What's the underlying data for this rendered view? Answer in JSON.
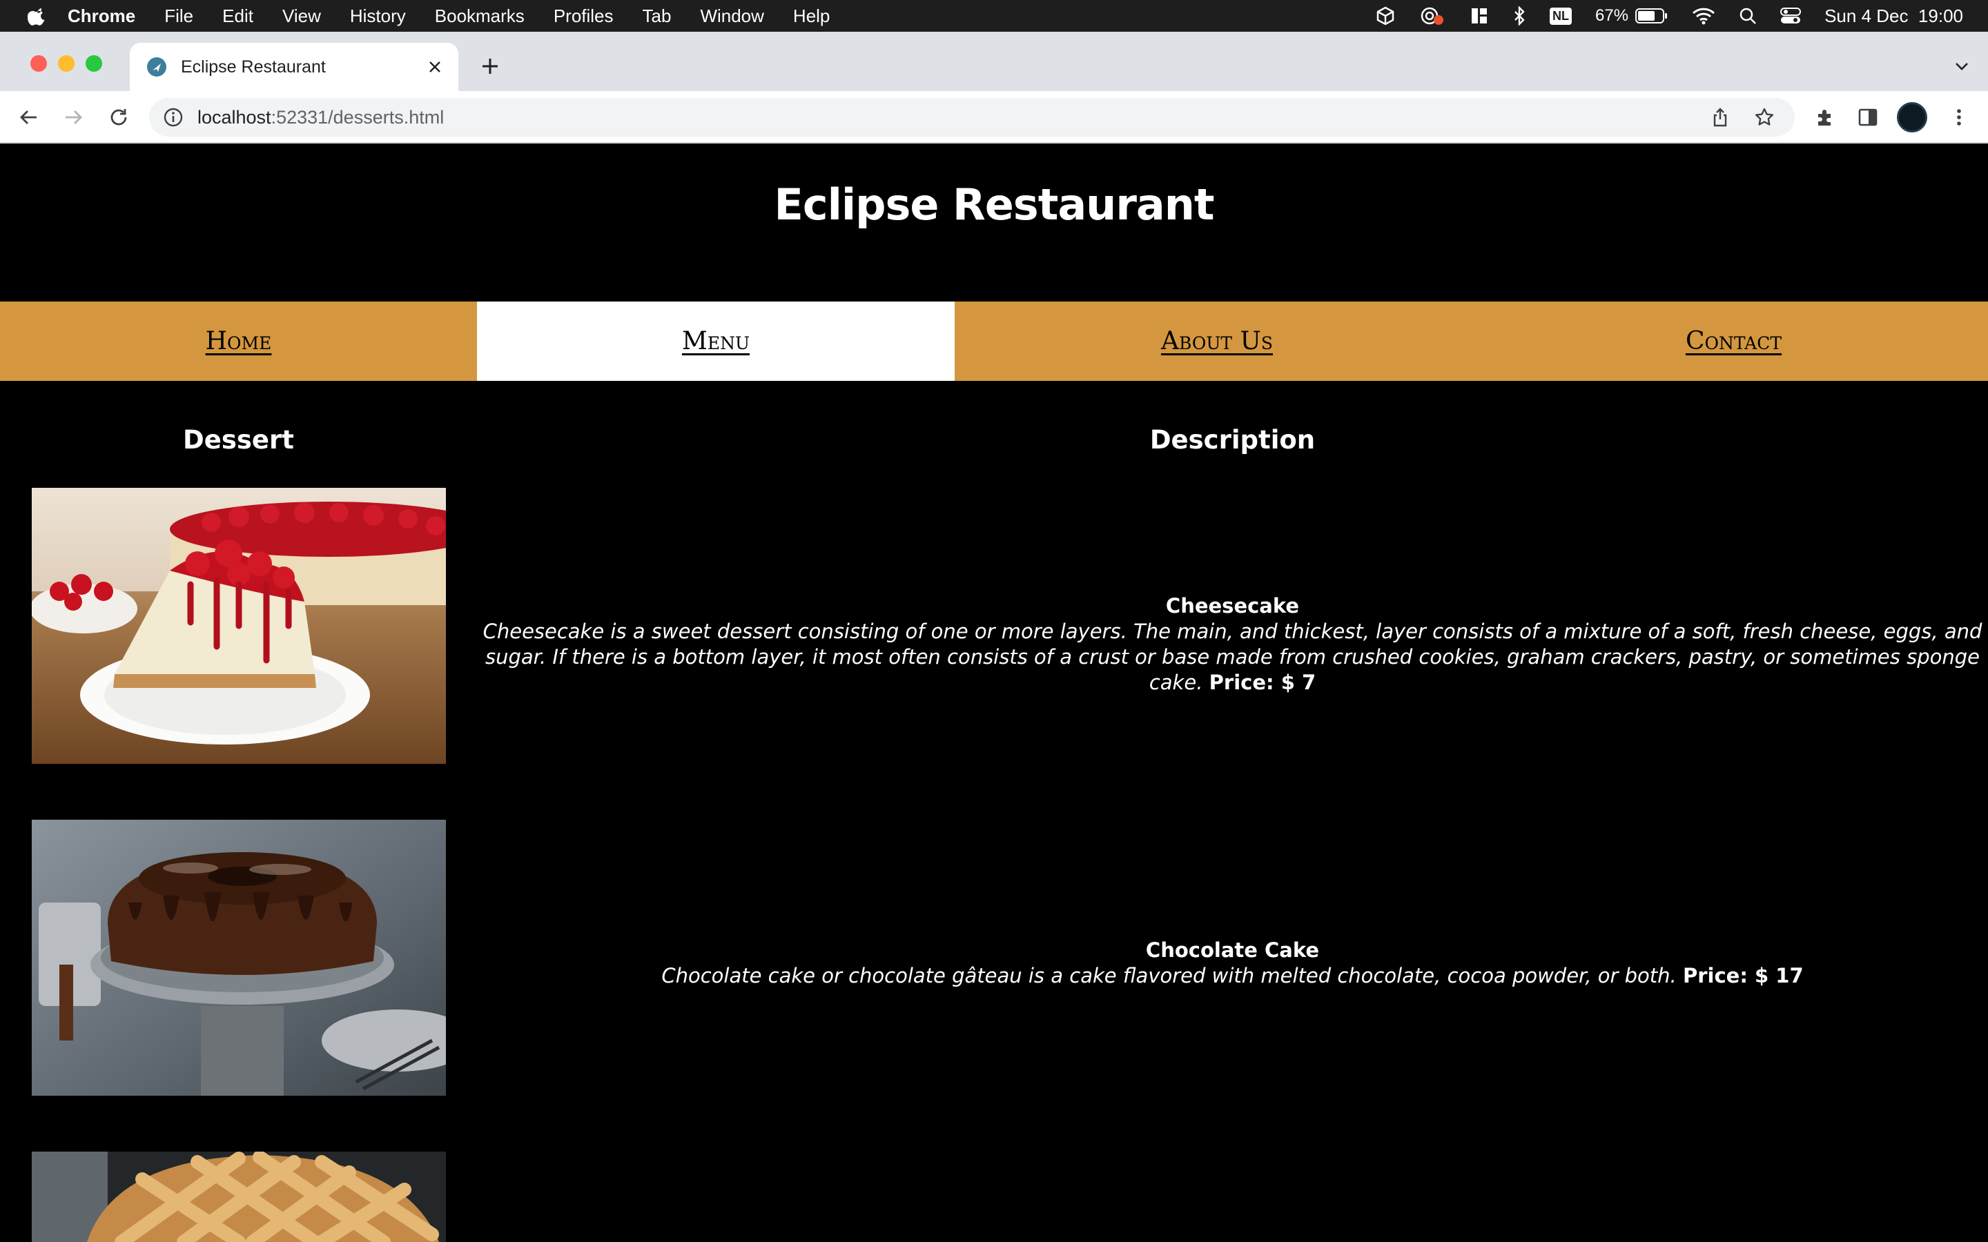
{
  "menubar": {
    "app_name": "Chrome",
    "items": [
      "File",
      "Edit",
      "View",
      "History",
      "Bookmarks",
      "Profiles",
      "Tab",
      "Window",
      "Help"
    ],
    "status": {
      "nl_badge": "NL",
      "battery": "67%",
      "datetime": "Sun 4 Dec  19:00"
    }
  },
  "browser": {
    "tab_title": "Eclipse Restaurant",
    "url_host": "localhost",
    "url_rest": ":52331/desserts.html"
  },
  "site": {
    "title": "Eclipse Restaurant",
    "nav": {
      "home": "Home",
      "menu": "Menu",
      "about": "About Us",
      "contact": "Contact"
    },
    "active_nav": "menu",
    "accent_color": "#d4973f"
  },
  "table": {
    "headers": {
      "dessert": "Dessert",
      "description": "Description"
    },
    "rows": [
      {
        "name": "Cheesecake",
        "description": "Cheesecake is a sweet dessert consisting of one or more layers. The main, and thickest, layer consists of a mixture of a soft, fresh cheese, eggs, and sugar. If there is a bottom layer, it most often consists of a crust or base made from crushed cookies, graham crackers, pastry, or sometimes sponge cake.",
        "price": "Price: $ 7",
        "image": "cheesecake-photo"
      },
      {
        "name": "Chocolate Cake",
        "description": "Chocolate cake or chocolate gâteau is a cake flavored with melted chocolate, cocoa powder, or both.",
        "price": "Price: $ 17",
        "image": "chocolate-cake-photo"
      },
      {
        "image": "pie-photo"
      }
    ]
  }
}
